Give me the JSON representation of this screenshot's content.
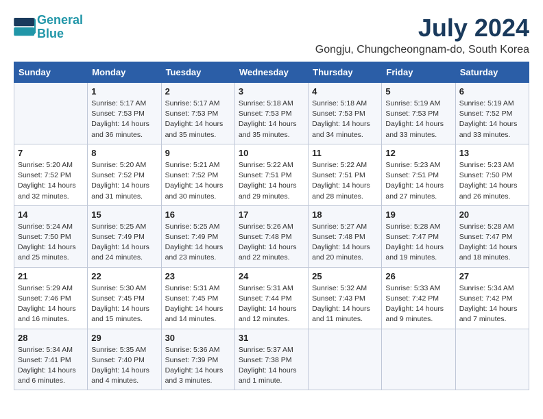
{
  "logo": {
    "line1": "General",
    "line2": "Blue"
  },
  "title": "July 2024",
  "subtitle": "Gongju, Chungcheongnam-do, South Korea",
  "days_of_week": [
    "Sunday",
    "Monday",
    "Tuesday",
    "Wednesday",
    "Thursday",
    "Friday",
    "Saturday"
  ],
  "weeks": [
    [
      {
        "num": "",
        "info": ""
      },
      {
        "num": "1",
        "info": "Sunrise: 5:17 AM\nSunset: 7:53 PM\nDaylight: 14 hours\nand 36 minutes."
      },
      {
        "num": "2",
        "info": "Sunrise: 5:17 AM\nSunset: 7:53 PM\nDaylight: 14 hours\nand 35 minutes."
      },
      {
        "num": "3",
        "info": "Sunrise: 5:18 AM\nSunset: 7:53 PM\nDaylight: 14 hours\nand 35 minutes."
      },
      {
        "num": "4",
        "info": "Sunrise: 5:18 AM\nSunset: 7:53 PM\nDaylight: 14 hours\nand 34 minutes."
      },
      {
        "num": "5",
        "info": "Sunrise: 5:19 AM\nSunset: 7:53 PM\nDaylight: 14 hours\nand 33 minutes."
      },
      {
        "num": "6",
        "info": "Sunrise: 5:19 AM\nSunset: 7:52 PM\nDaylight: 14 hours\nand 33 minutes."
      }
    ],
    [
      {
        "num": "7",
        "info": "Sunrise: 5:20 AM\nSunset: 7:52 PM\nDaylight: 14 hours\nand 32 minutes."
      },
      {
        "num": "8",
        "info": "Sunrise: 5:20 AM\nSunset: 7:52 PM\nDaylight: 14 hours\nand 31 minutes."
      },
      {
        "num": "9",
        "info": "Sunrise: 5:21 AM\nSunset: 7:52 PM\nDaylight: 14 hours\nand 30 minutes."
      },
      {
        "num": "10",
        "info": "Sunrise: 5:22 AM\nSunset: 7:51 PM\nDaylight: 14 hours\nand 29 minutes."
      },
      {
        "num": "11",
        "info": "Sunrise: 5:22 AM\nSunset: 7:51 PM\nDaylight: 14 hours\nand 28 minutes."
      },
      {
        "num": "12",
        "info": "Sunrise: 5:23 AM\nSunset: 7:51 PM\nDaylight: 14 hours\nand 27 minutes."
      },
      {
        "num": "13",
        "info": "Sunrise: 5:23 AM\nSunset: 7:50 PM\nDaylight: 14 hours\nand 26 minutes."
      }
    ],
    [
      {
        "num": "14",
        "info": "Sunrise: 5:24 AM\nSunset: 7:50 PM\nDaylight: 14 hours\nand 25 minutes."
      },
      {
        "num": "15",
        "info": "Sunrise: 5:25 AM\nSunset: 7:49 PM\nDaylight: 14 hours\nand 24 minutes."
      },
      {
        "num": "16",
        "info": "Sunrise: 5:25 AM\nSunset: 7:49 PM\nDaylight: 14 hours\nand 23 minutes."
      },
      {
        "num": "17",
        "info": "Sunrise: 5:26 AM\nSunset: 7:48 PM\nDaylight: 14 hours\nand 22 minutes."
      },
      {
        "num": "18",
        "info": "Sunrise: 5:27 AM\nSunset: 7:48 PM\nDaylight: 14 hours\nand 20 minutes."
      },
      {
        "num": "19",
        "info": "Sunrise: 5:28 AM\nSunset: 7:47 PM\nDaylight: 14 hours\nand 19 minutes."
      },
      {
        "num": "20",
        "info": "Sunrise: 5:28 AM\nSunset: 7:47 PM\nDaylight: 14 hours\nand 18 minutes."
      }
    ],
    [
      {
        "num": "21",
        "info": "Sunrise: 5:29 AM\nSunset: 7:46 PM\nDaylight: 14 hours\nand 16 minutes."
      },
      {
        "num": "22",
        "info": "Sunrise: 5:30 AM\nSunset: 7:45 PM\nDaylight: 14 hours\nand 15 minutes."
      },
      {
        "num": "23",
        "info": "Sunrise: 5:31 AM\nSunset: 7:45 PM\nDaylight: 14 hours\nand 14 minutes."
      },
      {
        "num": "24",
        "info": "Sunrise: 5:31 AM\nSunset: 7:44 PM\nDaylight: 14 hours\nand 12 minutes."
      },
      {
        "num": "25",
        "info": "Sunrise: 5:32 AM\nSunset: 7:43 PM\nDaylight: 14 hours\nand 11 minutes."
      },
      {
        "num": "26",
        "info": "Sunrise: 5:33 AM\nSunset: 7:42 PM\nDaylight: 14 hours\nand 9 minutes."
      },
      {
        "num": "27",
        "info": "Sunrise: 5:34 AM\nSunset: 7:42 PM\nDaylight: 14 hours\nand 7 minutes."
      }
    ],
    [
      {
        "num": "28",
        "info": "Sunrise: 5:34 AM\nSunset: 7:41 PM\nDaylight: 14 hours\nand 6 minutes."
      },
      {
        "num": "29",
        "info": "Sunrise: 5:35 AM\nSunset: 7:40 PM\nDaylight: 14 hours\nand 4 minutes."
      },
      {
        "num": "30",
        "info": "Sunrise: 5:36 AM\nSunset: 7:39 PM\nDaylight: 14 hours\nand 3 minutes."
      },
      {
        "num": "31",
        "info": "Sunrise: 5:37 AM\nSunset: 7:38 PM\nDaylight: 14 hours\nand 1 minute."
      },
      {
        "num": "",
        "info": ""
      },
      {
        "num": "",
        "info": ""
      },
      {
        "num": "",
        "info": ""
      }
    ]
  ]
}
